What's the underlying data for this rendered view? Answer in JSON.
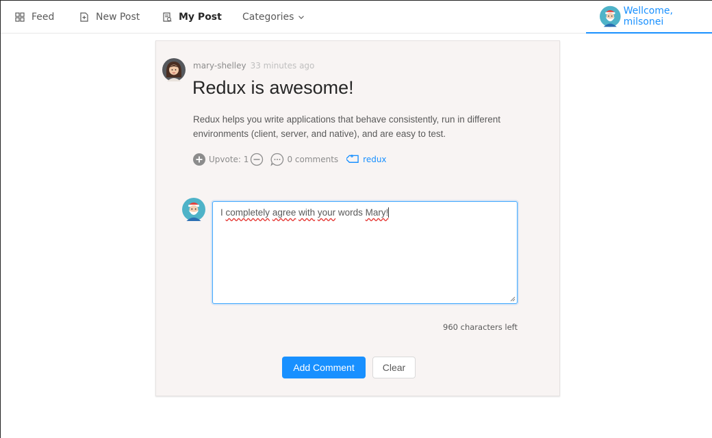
{
  "nav": {
    "items": [
      {
        "label": "Feed",
        "icon": "grid-icon"
      },
      {
        "label": "New Post",
        "icon": "new-file-icon"
      },
      {
        "label": "My Post",
        "icon": "document-list-icon",
        "active": true
      },
      {
        "label": "Categories",
        "icon": "chevron-down-icon"
      }
    ],
    "welcome": "Wellcome, milsonei"
  },
  "post": {
    "author": "mary-shelley",
    "time": "33 minutes ago",
    "title": "Redux is awesome!",
    "body": "Redux helps you write applications that behave consistently, run in different environments (client, server, and native), and are easy to test.",
    "upvote_label": "Upvote: 1",
    "comments_label": "0 comments",
    "tag": "redux"
  },
  "comment": {
    "value_parts": [
      "I ",
      "completely",
      " ",
      "agree",
      " ",
      "with",
      " ",
      "your",
      " words ",
      "Mary!"
    ],
    "chars_left": "960 characters left",
    "add_label": "Add Comment",
    "clear_label": "Clear"
  },
  "colors": {
    "accent": "#1890ff",
    "card_bg": "#f8f4f3",
    "spellcheck": "#e53935"
  }
}
